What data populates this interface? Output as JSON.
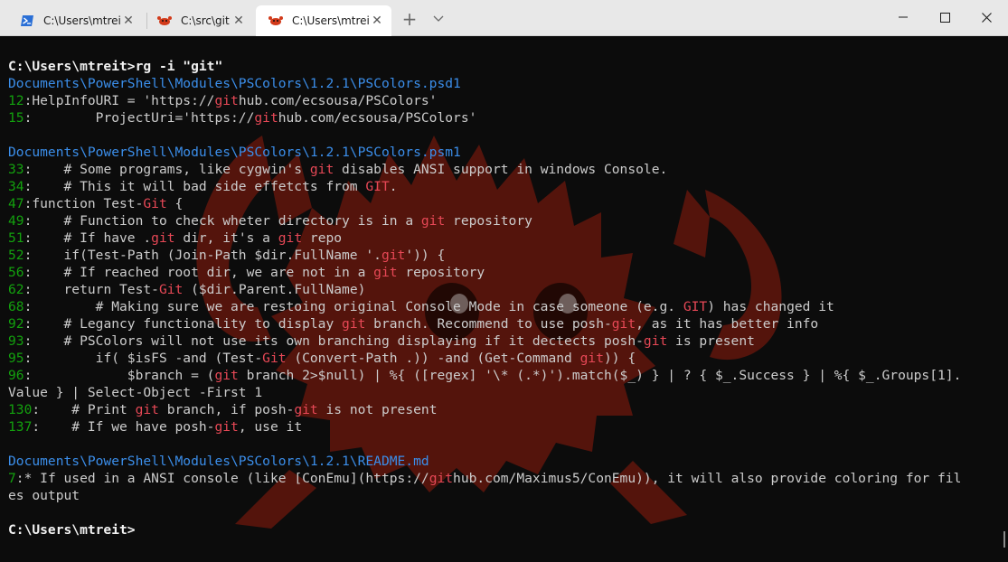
{
  "tabs": [
    {
      "label": "C:\\Users\\mtreit",
      "icon": "powershell-icon",
      "active": false
    },
    {
      "label": "C:\\src\\git",
      "icon": "ferris-crab-icon",
      "active": false
    },
    {
      "label": "C:\\Users\\mtreit",
      "icon": "ferris-crab-icon",
      "active": true
    }
  ],
  "window_controls": {
    "minimize": "minimize-icon",
    "maximize": "maximize-icon",
    "close": "close-icon"
  },
  "colors": {
    "prompt": "#f2f2f2",
    "file_path": "#3b8eea",
    "line_number": "#13a10e",
    "match": "#e74856",
    "text": "#cccccc",
    "background": "#0c0c0c",
    "watermark": "#8f1c0c"
  },
  "terminal": {
    "lines": [
      [
        {
          "t": "C:\\Users\\mtreit>",
          "c": "prompt"
        },
        {
          "t": "rg -i \"git\"",
          "c": "prompt"
        }
      ],
      [
        {
          "t": "Documents\\PowerShell\\Modules\\PSColors\\1.2.1\\PSColors.psd1",
          "c": "file"
        }
      ],
      [
        {
          "t": "12",
          "c": "num"
        },
        {
          "t": ":HelpInfoURI = 'https://"
        },
        {
          "t": "git",
          "c": "hl"
        },
        {
          "t": "hub.com/ecsousa/PSColors'"
        }
      ],
      [
        {
          "t": "15",
          "c": "num"
        },
        {
          "t": ":        ProjectUri='https://"
        },
        {
          "t": "git",
          "c": "hl"
        },
        {
          "t": "hub.com/ecsousa/PSColors'"
        }
      ],
      [],
      [
        {
          "t": "Documents\\PowerShell\\Modules\\PSColors\\1.2.1\\PSColors.psm1",
          "c": "file"
        }
      ],
      [
        {
          "t": "33",
          "c": "num"
        },
        {
          "t": ":    # Some programs, like cygwin's "
        },
        {
          "t": "git",
          "c": "hl"
        },
        {
          "t": " disables ANSI support in windows Console."
        }
      ],
      [
        {
          "t": "34",
          "c": "num"
        },
        {
          "t": ":    # This it will bad side effetcts from "
        },
        {
          "t": "GIT",
          "c": "hl"
        },
        {
          "t": "."
        }
      ],
      [
        {
          "t": "47",
          "c": "num"
        },
        {
          "t": ":function Test-"
        },
        {
          "t": "Git",
          "c": "hl"
        },
        {
          "t": " {"
        }
      ],
      [
        {
          "t": "49",
          "c": "num"
        },
        {
          "t": ":    # Function to check wheter directory is in a "
        },
        {
          "t": "git",
          "c": "hl"
        },
        {
          "t": " repository"
        }
      ],
      [
        {
          "t": "51",
          "c": "num"
        },
        {
          "t": ":    # If have ."
        },
        {
          "t": "git",
          "c": "hl"
        },
        {
          "t": " dir, it's a "
        },
        {
          "t": "git",
          "c": "hl"
        },
        {
          "t": " repo"
        }
      ],
      [
        {
          "t": "52",
          "c": "num"
        },
        {
          "t": ":    if(Test-Path (Join-Path $dir.FullName '."
        },
        {
          "t": "git",
          "c": "hl"
        },
        {
          "t": "')) {"
        }
      ],
      [
        {
          "t": "56",
          "c": "num"
        },
        {
          "t": ":    # If reached root dir, we are not in a "
        },
        {
          "t": "git",
          "c": "hl"
        },
        {
          "t": " repository"
        }
      ],
      [
        {
          "t": "62",
          "c": "num"
        },
        {
          "t": ":    return Test-"
        },
        {
          "t": "Git",
          "c": "hl"
        },
        {
          "t": " ($dir.Parent.FullName)"
        }
      ],
      [
        {
          "t": "68",
          "c": "num"
        },
        {
          "t": ":        # Making sure we are restoing original Console Mode in case someone (e.g. "
        },
        {
          "t": "GIT",
          "c": "hl"
        },
        {
          "t": ") has changed it"
        }
      ],
      [
        {
          "t": "92",
          "c": "num"
        },
        {
          "t": ":    # Legancy functionality to display "
        },
        {
          "t": "git",
          "c": "hl"
        },
        {
          "t": " branch. Recommend to use posh-"
        },
        {
          "t": "git",
          "c": "hl"
        },
        {
          "t": ", as it has better info"
        }
      ],
      [
        {
          "t": "93",
          "c": "num"
        },
        {
          "t": ":    # PSColors will not use its own branching displaying if it dectects posh-"
        },
        {
          "t": "git",
          "c": "hl"
        },
        {
          "t": " is present"
        }
      ],
      [
        {
          "t": "95",
          "c": "num"
        },
        {
          "t": ":        if( $isFS -and (Test-"
        },
        {
          "t": "Git",
          "c": "hl"
        },
        {
          "t": " (Convert-Path .)) -and (Get-Command "
        },
        {
          "t": "git",
          "c": "hl"
        },
        {
          "t": ")) {"
        }
      ],
      [
        {
          "t": "96",
          "c": "num"
        },
        {
          "t": ":            $branch = ("
        },
        {
          "t": "git",
          "c": "hl"
        },
        {
          "t": " branch 2>$null) | %{ ([regex] '\\* (.*)').match($_) } | ? { $_.Success } | %{ $_.Groups[1]."
        }
      ],
      [
        {
          "t": "Value } | Select-Object -First 1"
        }
      ],
      [
        {
          "t": "130",
          "c": "num"
        },
        {
          "t": ":    # Print "
        },
        {
          "t": "git",
          "c": "hl"
        },
        {
          "t": " branch, if posh-"
        },
        {
          "t": "git",
          "c": "hl"
        },
        {
          "t": " is not present"
        }
      ],
      [
        {
          "t": "137",
          "c": "num"
        },
        {
          "t": ":    # If we have posh-"
        },
        {
          "t": "git",
          "c": "hl"
        },
        {
          "t": ", use it"
        }
      ],
      [],
      [
        {
          "t": "Documents\\PowerShell\\Modules\\PSColors\\1.2.1\\README.md",
          "c": "file"
        }
      ],
      [
        {
          "t": "7",
          "c": "num"
        },
        {
          "t": ":* If used in a ANSI console (like [ConEmu](https://"
        },
        {
          "t": "git",
          "c": "hl"
        },
        {
          "t": "hub.com/Maximus5/ConEmu)), it will also provide coloring for fil"
        }
      ],
      [
        {
          "t": "es output"
        }
      ],
      [],
      [
        {
          "t": "C:\\Users\\mtreit>",
          "c": "prompt"
        }
      ]
    ]
  }
}
